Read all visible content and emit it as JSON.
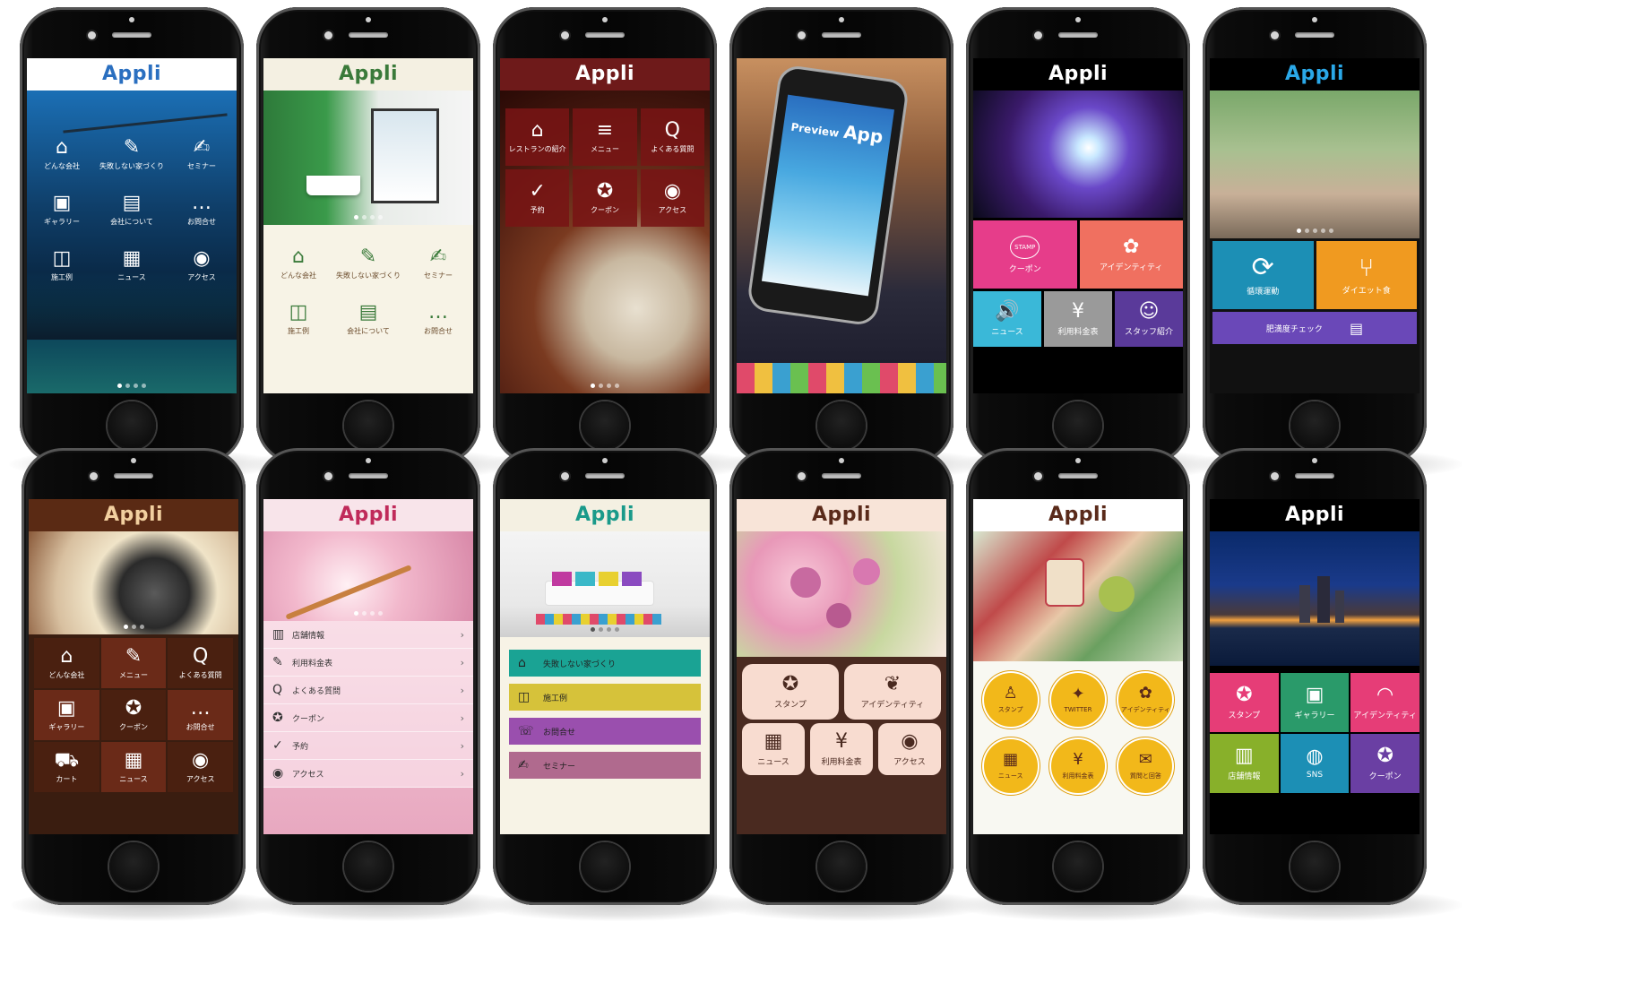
{
  "logo": {
    "text": "Appli"
  },
  "phones": [
    {
      "id": "p1",
      "icons": [
        [
          "⌂",
          "どんな会社"
        ],
        [
          "✎",
          "失敗しない家づくり"
        ],
        [
          "✍",
          "セミナー"
        ],
        [
          "▣",
          "ギャラリー"
        ],
        [
          "▤",
          "会社について"
        ],
        [
          "…",
          "お問合せ"
        ],
        [
          "◫",
          "施工例"
        ],
        [
          "▦",
          "ニュース"
        ],
        [
          "◉",
          "アクセス"
        ]
      ]
    },
    {
      "id": "p2",
      "icons": [
        [
          "⌂",
          "どんな会社"
        ],
        [
          "✎",
          "失敗しない家づくり"
        ],
        [
          "✍",
          "セミナー"
        ],
        [
          "◫",
          "施工例"
        ],
        [
          "▤",
          "会社について"
        ],
        [
          "…",
          "お問合せ"
        ]
      ]
    },
    {
      "id": "p3",
      "icons": [
        [
          "⌂",
          "レストランの紹介"
        ],
        [
          "≡",
          "メニュー"
        ],
        [
          "Q",
          "よくある質問"
        ],
        [
          "✓",
          "予約"
        ],
        [
          "✪",
          "クーポン"
        ],
        [
          "◉",
          "アクセス"
        ]
      ]
    },
    {
      "id": "p4",
      "preview_text": "Preview",
      "app_text": "App"
    },
    {
      "id": "p5",
      "tiles": [
        "クーポン",
        "アイデンティティ",
        "ニュース",
        "利用料金表",
        "スタッフ紹介"
      ],
      "stamp": "STAMP"
    },
    {
      "id": "p6",
      "tiles": [
        "循環運動",
        "ダイエット食",
        "肥満度チェック"
      ]
    },
    {
      "id": "p7",
      "icons": [
        [
          "⌂",
          "どんな会社"
        ],
        [
          "✎",
          "メニュー"
        ],
        [
          "Q",
          "よくある質問"
        ],
        [
          "▣",
          "ギャラリー"
        ],
        [
          "✪",
          "クーポン"
        ],
        [
          "…",
          "お問合せ"
        ],
        [
          "⛟",
          "カート"
        ],
        [
          "▦",
          "ニュース"
        ],
        [
          "◉",
          "アクセス"
        ]
      ]
    },
    {
      "id": "p8",
      "rows": [
        [
          "▥",
          "店舗情報"
        ],
        [
          "✎",
          "利用料金表"
        ],
        [
          "Q",
          "よくある質問"
        ],
        [
          "✪",
          "クーポン"
        ],
        [
          "✓",
          "予約"
        ],
        [
          "◉",
          "アクセス"
        ]
      ]
    },
    {
      "id": "p9",
      "bars": [
        [
          "⌂",
          "失敗しない家づくり",
          "#1aa394"
        ],
        [
          "◫",
          "施工例",
          "#d6c23a"
        ],
        [
          "☏",
          "お問合せ",
          "#9a4fae"
        ],
        [
          "✍",
          "セミナー",
          "#b06a8e"
        ]
      ]
    },
    {
      "id": "p10",
      "icons": [
        [
          "✪",
          "スタンプ"
        ],
        [
          "❦",
          "アイデンティティ"
        ],
        [
          "▦",
          "ニュース"
        ],
        [
          "¥",
          "利用料金表"
        ],
        [
          "◉",
          "アクセス"
        ]
      ]
    },
    {
      "id": "p11",
      "icons": [
        [
          "♙",
          "スタンプ"
        ],
        [
          "✦",
          "TWITTER"
        ],
        [
          "✿",
          "アイデンティティ"
        ],
        [
          "▦",
          "ニュース"
        ],
        [
          "¥",
          "利用料金表"
        ],
        [
          "✉",
          "質問と回答"
        ]
      ]
    },
    {
      "id": "p12",
      "tiles": [
        [
          "✪",
          "スタンプ",
          "#e63d77"
        ],
        [
          "▣",
          "ギャラリー",
          "#2a9a6a"
        ],
        [
          "◠",
          "アイデンティティ",
          "#e63d77"
        ],
        [
          "▥",
          "店舗情報",
          "#88b02a"
        ],
        [
          "◍",
          "SNS",
          "#1c8fb5"
        ],
        [
          "✪",
          "クーポン",
          "#6a3fa3"
        ]
      ]
    }
  ],
  "colors": {
    "logo_blue": "#2a6fc0",
    "logo_green": "#3a7a3a",
    "coffee": "#3a1d10"
  }
}
